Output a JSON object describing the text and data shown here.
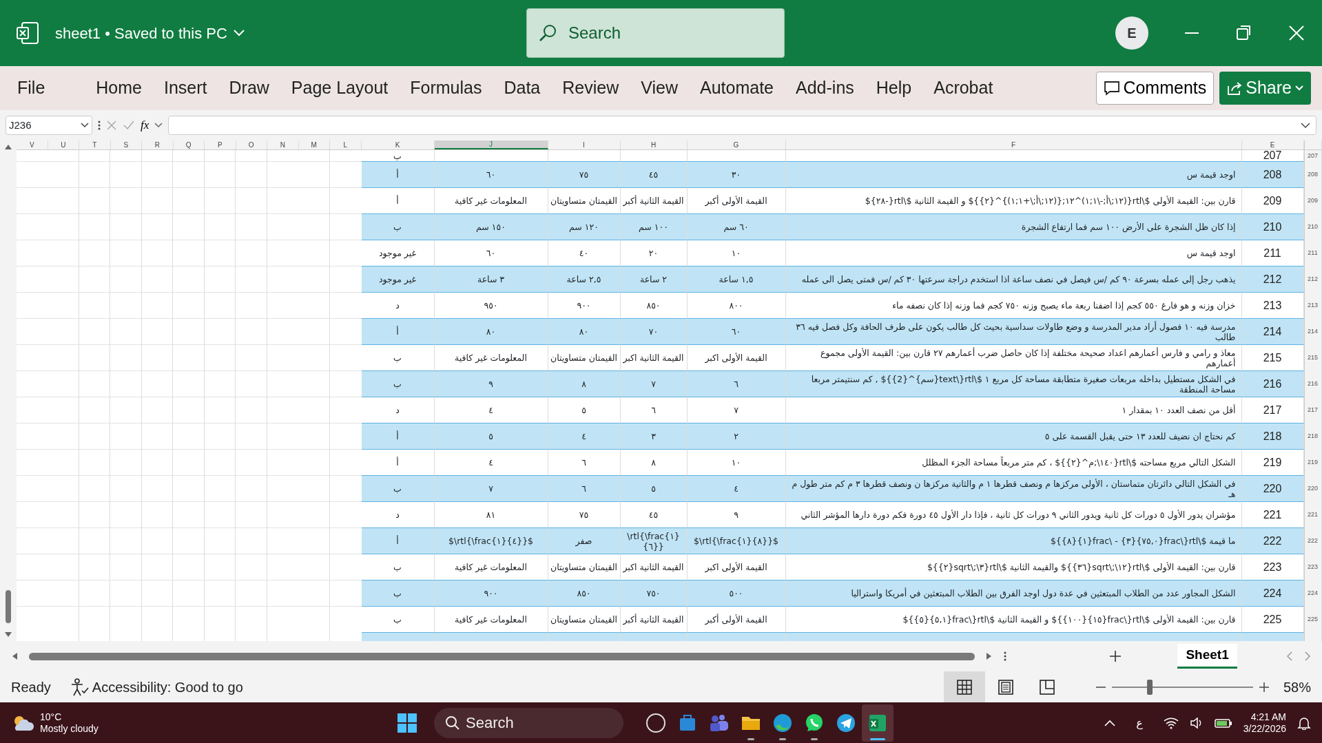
{
  "window": {
    "title": "sheet1 • Saved to this PC",
    "account_initial": "E"
  },
  "search": {
    "placeholder": "Search"
  },
  "ribbon_tabs": [
    "Acrobat",
    "Help",
    "Add-ins",
    "Automate",
    "View",
    "Review",
    "Data",
    "Formulas",
    "Page Layout",
    "Draw",
    "Insert",
    "Home",
    "File"
  ],
  "ribbon_buttons": [
    {
      "kind": "share",
      "label": "Share"
    },
    {
      "kind": "comments",
      "label": "Comments"
    }
  ],
  "formula_bar": {
    "name_box": "J236",
    "function_label": "fx"
  },
  "columns": [
    {
      "label": "E",
      "selected": false
    },
    {
      "label": "F",
      "selected": false
    },
    {
      "label": "G",
      "selected": false
    },
    {
      "label": "H",
      "selected": false
    },
    {
      "label": "I",
      "selected": false
    },
    {
      "label": "J",
      "selected": true
    },
    {
      "label": "K",
      "selected": false
    },
    {
      "label": "L",
      "selected": false
    },
    {
      "label": "M",
      "selected": false
    },
    {
      "label": "N",
      "selected": false
    },
    {
      "label": "O",
      "selected": false
    },
    {
      "label": "P",
      "selected": false
    },
    {
      "label": "Q",
      "selected": false
    },
    {
      "label": "R",
      "selected": false
    },
    {
      "label": "S",
      "selected": false
    },
    {
      "label": "T",
      "selected": false
    },
    {
      "label": "U",
      "selected": false
    },
    {
      "label": "V",
      "selected": false
    }
  ],
  "rows": [
    {
      "number": "207",
      "answer": "ب"
    },
    {
      "number": "208",
      "question": "اوجد قيمة س",
      "options": [
        "٣٠",
        "٤٥",
        "٧٥",
        "٦٠"
      ],
      "answer": "أ"
    },
    {
      "number": "209",
      "question": "قارن بين: القيمة الأولى $\\rtl{(١٢;\\أ;-\\١;١)^١٢;{(١٢;\\أ;\\+١;١)}^{٢}}$ و القيمة الثانية $\\rtl{-٢٨}$",
      "options": [
        "القيمة الأولى أكبر",
        "القيمة الثانية أكبر",
        "القيمتان متساويتان",
        "المعلومات غير كافية"
      ],
      "answer": "أ"
    },
    {
      "number": "210",
      "question": "إذا كان ظل الشجرة على الأرض ١٠٠ سم فما ارتفاع الشجرة",
      "options": [
        "٦٠ سم",
        "١٠٠ سم",
        "١٢٠ سم",
        "١٥٠ سم"
      ],
      "answer": "ب"
    },
    {
      "number": "211",
      "question": "اوجد قيمة س",
      "options": [
        "١٠",
        "٢٠",
        "٤٠",
        "٦٠"
      ],
      "answer": "غير موجود"
    },
    {
      "number": "212",
      "question": "يذهب رجل إلى عمله بسرعة ٩٠ كم /س فيصل في نصف ساعة اذا استخدم دراجة سرعتها ٣٠ كم /س فمتى يصل الى عمله",
      "options": [
        "١,٥ ساعة",
        "٢ ساعة",
        "٢,٥ ساعة",
        "٣ ساعة"
      ],
      "answer": "غير موجود"
    },
    {
      "number": "213",
      "question": "خزان وزنه و هو فارغ ٥٥٠ كجم إذا اضفنا ربعة ماء يصبح وزنه ٧٥٠ كجم فما وزنه إذا كان نصفه ماء",
      "options": [
        "٨٠٠",
        "٨٥٠",
        "٩٠٠",
        "٩٥٠"
      ],
      "answer": "د"
    },
    {
      "number": "214",
      "question": "مدرسة فيه ١٠ فصول أراد مدير المدرسة و وضع طاولات سداسية بحيث كل طالب يكون على طرف الحافة وكل فصل فيه ٣٦ طالب",
      "options": [
        "٦٠",
        "٧٠",
        "٨٠",
        "٨٠"
      ],
      "answer": "أ"
    },
    {
      "number": "215",
      "question": "معاذ و رامي و فارس أعمارهم اعداد صحيحة مختلفة إذا كان حاصل ضرب أعمارهم ٢٧ قارن بين: القيمة الأولى مجموع أعمارهم",
      "options": [
        "القيمة الأولى اكبر",
        "القيمة الثانية اكبر",
        "القيمتان متساويتان",
        "المعلومات غير كافية"
      ],
      "answer": "ب"
    },
    {
      "number": "216",
      "question": "في الشكل مستطيل بداخله مربعات صغيرة متطابقة مساحة كل مربع ١ $\\rtl{\\text{سم}^{2}}$ , كم سنتيمتر مربعا مساحة المنطقة",
      "options": [
        "٦",
        "٧",
        "٨",
        "٩"
      ],
      "answer": "ب"
    },
    {
      "number": "217",
      "question": "أقل من نصف العدد ١٠ بمقدار ١",
      "options": [
        "٧",
        "٦",
        "٥",
        "٤"
      ],
      "answer": "د"
    },
    {
      "number": "218",
      "question": "كم نحتاج ان نضيف للعدد ١٣ حتى يقبل القسمة على ٥",
      "options": [
        "٢",
        "٣",
        "٤",
        "٥"
      ],
      "answer": "أ"
    },
    {
      "number": "219",
      "question": "الشكل التالي مربع مساحته $\\rtl{١٤٠\\;م^{٢}}$ ، كم متر مربعاً مساحة الجزء المظلل",
      "options": [
        "١٠",
        "٨",
        "٦",
        "٤"
      ],
      "answer": "أ"
    },
    {
      "number": "220",
      "question": "في الشكل التالي دائرتان متماستان ، الأولى مركزها م ونصف قطرها ١ م والثانية مركزها ن ونصف قطرها ٣ م كم متر طول م هـ",
      "options": [
        "٤",
        "٥",
        "٦",
        "٧"
      ],
      "answer": "ب"
    },
    {
      "number": "221",
      "question": "مؤشران يدور الأول ٥ دورات كل ثانية ويدور الثاني ٩ دورات كل ثانية ، فإذا دار الأول ٤٥ دورة فكم دورة دارها المؤشر الثاني",
      "options": [
        "٩",
        "٤٥",
        "٧٥",
        "٨١"
      ],
      "answer": "د"
    },
    {
      "number": "222",
      "question": "ما قيمة $\\rtl{\\frac{٧٥,٠}{٣} - \\frac{١}{٨}}$",
      "options": [
        "$\\rtl{\\frac{١}{٨}}$",
        "\\rtl{\\frac{١}{٦}}",
        "صفر",
        "$\\rtl{\\frac{١}{٤}}$"
      ],
      "answer": "أ"
    },
    {
      "number": "223",
      "question": "قارن بين: القيمة الأولى $\\rtl{١٢\\;\\sqrt{٣٦}}$ والقيمة الثانية $\\rtl{٣\\;\\sqrt{٢}}$",
      "options": [
        "القيمة الأولى اكبر",
        "القيمة الثانية اكبر",
        "القيمتان متساويتان",
        "المعلومات غير كافية"
      ],
      "answer": "ب"
    },
    {
      "number": "224",
      "question": "الشكل المجاور عدد من الطلاب المبتعثين في عدة دول اوجد الفرق بين الطلاب المبتعثين في أمريكا واستراليا",
      "options": [
        "٥٠٠",
        "٧٥٠",
        "٨٥٠",
        "٩٠٠"
      ],
      "answer": "ب"
    },
    {
      "number": "225",
      "question": "قارن بين: القيمة الأولى $\\rtl{\\frac{١٥}{١٠٠}}$ و القيمة الثانية $\\rtl{\\frac{٥,١}{٥}}$",
      "options": [
        "القيمة الأولى أكبر",
        "القيمة الثانية أكبر",
        "القيمتان متساويتان",
        "المعلومات غير كافية"
      ],
      "answer": "ب"
    }
  ],
  "row_headers": [
    "207",
    "208",
    "209",
    "210",
    "211",
    "212",
    "213",
    "214",
    "215",
    "216",
    "217",
    "218",
    "219",
    "220",
    "221",
    "222",
    "223",
    "224",
    "225"
  ],
  "sheet_tabs": [
    {
      "label": "Sheet1",
      "selected": true
    }
  ],
  "status_bar": {
    "mode": "Ready",
    "accessibility": "Accessibility: Good to go",
    "views": [
      {
        "kind": "normal",
        "selected": true
      },
      {
        "kind": "page-layout",
        "selected": false
      },
      {
        "kind": "page-break",
        "selected": false
      }
    ],
    "zoom": {
      "level": 0.27,
      "reading": "58%"
    }
  },
  "taskbar": {
    "weather": {
      "temperature": "10°C",
      "condition": "Mostly cloudy"
    },
    "search_placeholder": "Search",
    "apps": [
      {
        "kind": "circle",
        "running": false,
        "selected": false
      },
      {
        "kind": "store",
        "running": false,
        "selected": false
      },
      {
        "kind": "teams",
        "running": false,
        "selected": false
      },
      {
        "kind": "folder",
        "running": true,
        "selected": false
      },
      {
        "kind": "edge",
        "running": true,
        "selected": false
      },
      {
        "kind": "whatsapp",
        "running": true,
        "selected": false
      },
      {
        "kind": "telegram",
        "running": false,
        "selected": false
      },
      {
        "kind": "excel",
        "running": true,
        "selected": true
      }
    ],
    "tray": {
      "language": "ع",
      "time": "4:21 AM",
      "date": "3/22/2026"
    }
  }
}
